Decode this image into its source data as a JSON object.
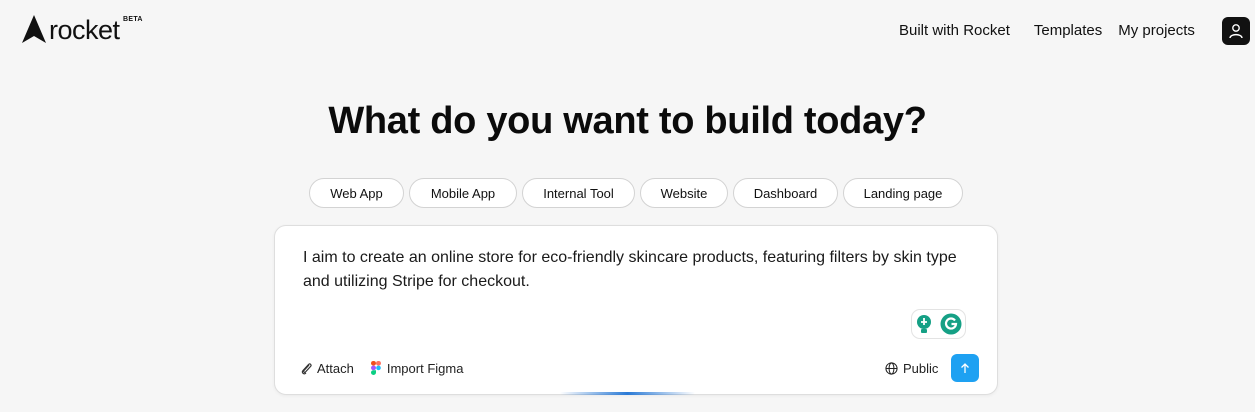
{
  "brand": {
    "name": "rocket",
    "badge": "BETA"
  },
  "nav": [
    {
      "label": "Built with Rocket"
    },
    {
      "label": "Templates"
    },
    {
      "label": "My projects"
    }
  ],
  "profile_icon": "user-icon",
  "headline": "What do you want to build today?",
  "chips": [
    {
      "label": "Web App"
    },
    {
      "label": "Mobile App"
    },
    {
      "label": "Internal Tool"
    },
    {
      "label": "Website"
    },
    {
      "label": "Dashboard"
    },
    {
      "label": "Landing page"
    }
  ],
  "prompt": {
    "value": "I aim to create an online store for eco-friendly skincare products, featuring filters by skin type and utilizing Stripe for checkout."
  },
  "actions": {
    "attach": "Attach",
    "import_figma": "Import Figma",
    "visibility": "Public"
  },
  "colors": {
    "accent": "#1ea1f2",
    "grammarly": "#15a085",
    "page_bg": "#f6f6f6"
  }
}
